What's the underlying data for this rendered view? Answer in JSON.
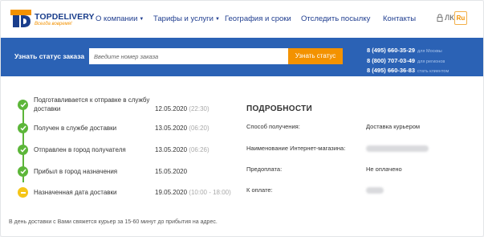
{
  "logo": {
    "name": "TOPDELIVERY",
    "tagline": "Всегда вовремя!",
    "brand_color": "#1a3e8c",
    "accent_color": "#f39200"
  },
  "nav": {
    "items": [
      {
        "label": "О компании",
        "has_dropdown": true
      },
      {
        "label": "Тарифы и услуги",
        "has_dropdown": true
      },
      {
        "label": "География и сроки",
        "has_dropdown": false
      },
      {
        "label": "Отследить посылку",
        "has_dropdown": false
      },
      {
        "label": "Контакты",
        "has_dropdown": false
      }
    ],
    "account_label": "ЛК",
    "account_icon": "lock-icon",
    "lang": "Ru"
  },
  "tracking": {
    "label": "Узнать статус заказа",
    "placeholder": "Введите номер заказа",
    "button_label": "Узнать статус",
    "bar_color": "#2b62b5"
  },
  "phones": [
    {
      "number": "8 (495) 660-35-29",
      "note": "для Москвы"
    },
    {
      "number": "8 (800) 707-03-49",
      "note": "для регионов"
    },
    {
      "number": "8 (495) 660-36-83",
      "note": "стать клиентом"
    }
  ],
  "steps": [
    {
      "label": "Подготавливается к отправке в службу доставки",
      "date": "12.05.2020",
      "time": "(22:30)",
      "status": "done"
    },
    {
      "label": "Получен в службе доставки",
      "date": "13.05.2020",
      "time": "(06:20)",
      "status": "done"
    },
    {
      "label": "Отправлен в город получателя",
      "date": "13.05.2020",
      "time": "(06:26)",
      "status": "done"
    },
    {
      "label": "Прибыл в город назначения",
      "date": "15.05.2020",
      "time": "",
      "status": "done"
    },
    {
      "label": "Назначенная дата доставки",
      "date": "19.05.2020",
      "time": "(10:00 - 18:00)",
      "status": "pending"
    }
  ],
  "details": {
    "title": "ПОДРОБНОСТИ",
    "rows": [
      {
        "label": "Способ получения:",
        "value": "Доставка курьером",
        "hidden": false
      },
      {
        "label": "Наименование Интернет-магазина:",
        "value": "",
        "hidden": true
      },
      {
        "label": "Предоплата:",
        "value": "Не оплачено",
        "hidden": false
      },
      {
        "label": "К оплате:",
        "value": "",
        "hidden": true
      }
    ]
  },
  "footnote": "В день доставки с Вами свяжется курьер за 15-60 минут до прибытия на адрес."
}
